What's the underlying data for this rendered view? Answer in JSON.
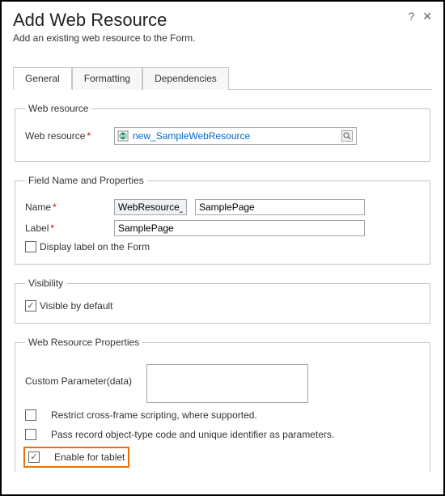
{
  "header": {
    "title": "Add Web Resource",
    "subtitle": "Add an existing web resource to the Form.",
    "help_label": "?",
    "close_label": "✕"
  },
  "tabs": {
    "general": "General",
    "formatting": "Formatting",
    "dependencies": "Dependencies"
  },
  "webResource": {
    "legend": "Web resource",
    "label": "Web resource",
    "value": "new_SampleWebResource"
  },
  "fieldNameProps": {
    "legend": "Field Name and Properties",
    "nameLabel": "Name",
    "namePrefix": "WebResource_",
    "nameValue": "SamplePage",
    "labelLabel": "Label",
    "labelValue": "SamplePage",
    "displayLabel": "Display label on the Form"
  },
  "visibility": {
    "legend": "Visibility",
    "visibleByDefault": "Visible by default"
  },
  "wrProps": {
    "legend": "Web Resource Properties",
    "customParamLabel": "Custom Parameter(data)",
    "customParamValue": "",
    "restrictCross": "Restrict cross-frame scripting, where supported.",
    "passRecord": "Pass record object-type code and unique identifier as parameters.",
    "enableTablet": "Enable for tablet"
  }
}
